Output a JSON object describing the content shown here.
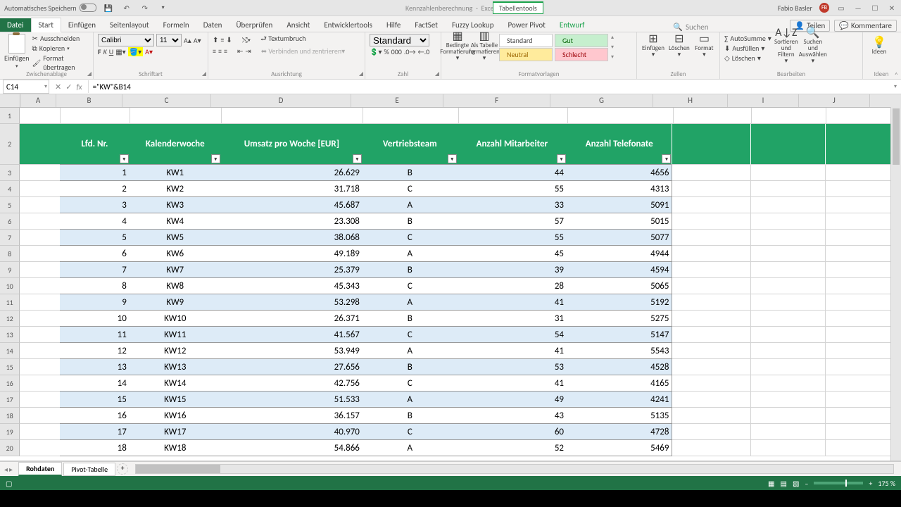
{
  "title": {
    "autosave": "Automatisches Speichern",
    "doc": "Kennzahlenberechnung",
    "app": "Excel",
    "tools": "Tabellentools",
    "user": "Fabio Basler",
    "initials": "FB"
  },
  "menu": {
    "file": "Datei",
    "tabs": [
      "Start",
      "Einfügen",
      "Seitenlayout",
      "Formeln",
      "Daten",
      "Überprüfen",
      "Ansicht",
      "Entwicklertools",
      "Hilfe",
      "FactSet",
      "Fuzzy Lookup",
      "Power Pivot",
      "Entwurf"
    ],
    "active": "Start",
    "search": "Suchen",
    "share": "Teilen",
    "comments": "Kommentare"
  },
  "ribbon": {
    "clipboard": {
      "paste": "Einfügen",
      "cut": "Ausschneiden",
      "copy": "Kopieren",
      "format": "Format übertragen",
      "label": "Zwischenablage"
    },
    "font": {
      "name": "Calibri",
      "size": "11",
      "label": "Schriftart"
    },
    "align": {
      "wrap": "Textumbruch",
      "merge": "Verbinden und zentrieren",
      "label": "Ausrichtung"
    },
    "number": {
      "format": "Standard",
      "label": "Zahl"
    },
    "styles": {
      "cond": "Bedingte Formatierung",
      "astable": "Als Tabelle formatieren",
      "std": "Standard",
      "gut": "Gut",
      "neutral": "Neutral",
      "bad": "Schlecht",
      "label": "Formatvorlagen"
    },
    "cells": {
      "insert": "Einfügen",
      "delete": "Löschen",
      "format": "Format",
      "label": "Zellen"
    },
    "editing": {
      "sum": "AutoSumme",
      "fill": "Ausfüllen",
      "clear": "Löschen",
      "sort": "Sortieren und Filtern",
      "find": "Suchen und Auswählen",
      "label": "Bearbeiten"
    },
    "ideas": {
      "label": "Ideen"
    }
  },
  "cellref": {
    "name": "C14",
    "formula": "=\"KW\"&B14"
  },
  "columns": {
    "A": 50,
    "B": 93,
    "C": 125,
    "D": 198,
    "E": 130,
    "F": 151,
    "G": 145,
    "H": 105,
    "I": 100,
    "J": 100
  },
  "headers": [
    "Lfd. Nr.",
    "Kalenderwoche",
    "Umsatz pro Woche [EUR]",
    "Vertriebsteam",
    "Anzahl Mitarbeiter",
    "Anzahl Telefonate"
  ],
  "chart_data": {
    "type": "table",
    "rows": [
      {
        "n": 1,
        "kw": "KW1",
        "umsatz": "26.629",
        "team": "B",
        "ma": 44,
        "tel": 4656
      },
      {
        "n": 2,
        "kw": "KW2",
        "umsatz": "31.718",
        "team": "C",
        "ma": 55,
        "tel": 4313
      },
      {
        "n": 3,
        "kw": "KW3",
        "umsatz": "45.687",
        "team": "A",
        "ma": 33,
        "tel": 5091
      },
      {
        "n": 4,
        "kw": "KW4",
        "umsatz": "23.308",
        "team": "B",
        "ma": 57,
        "tel": 5015
      },
      {
        "n": 5,
        "kw": "KW5",
        "umsatz": "38.068",
        "team": "C",
        "ma": 55,
        "tel": 5077
      },
      {
        "n": 6,
        "kw": "KW6",
        "umsatz": "49.189",
        "team": "A",
        "ma": 45,
        "tel": 4944
      },
      {
        "n": 7,
        "kw": "KW7",
        "umsatz": "25.379",
        "team": "B",
        "ma": 39,
        "tel": 4594
      },
      {
        "n": 8,
        "kw": "KW8",
        "umsatz": "45.343",
        "team": "C",
        "ma": 28,
        "tel": 5065
      },
      {
        "n": 9,
        "kw": "KW9",
        "umsatz": "53.298",
        "team": "A",
        "ma": 41,
        "tel": 5192
      },
      {
        "n": 10,
        "kw": "KW10",
        "umsatz": "26.371",
        "team": "B",
        "ma": 31,
        "tel": 5275
      },
      {
        "n": 11,
        "kw": "KW11",
        "umsatz": "41.567",
        "team": "C",
        "ma": 54,
        "tel": 5147
      },
      {
        "n": 12,
        "kw": "KW12",
        "umsatz": "53.949",
        "team": "A",
        "ma": 41,
        "tel": 5543
      },
      {
        "n": 13,
        "kw": "KW13",
        "umsatz": "27.656",
        "team": "B",
        "ma": 53,
        "tel": 4528
      },
      {
        "n": 14,
        "kw": "KW14",
        "umsatz": "42.756",
        "team": "C",
        "ma": 41,
        "tel": 4165
      },
      {
        "n": 15,
        "kw": "KW15",
        "umsatz": "51.533",
        "team": "A",
        "ma": 49,
        "tel": 4241
      },
      {
        "n": 16,
        "kw": "KW16",
        "umsatz": "36.157",
        "team": "B",
        "ma": 43,
        "tel": 5135
      },
      {
        "n": 17,
        "kw": "KW17",
        "umsatz": "40.970",
        "team": "C",
        "ma": 60,
        "tel": 4728
      },
      {
        "n": 18,
        "kw": "KW18",
        "umsatz": "54.866",
        "team": "A",
        "ma": 52,
        "tel": 5469
      }
    ]
  },
  "sheets": {
    "active": "Rohdaten",
    "other": "Pivot-Tabelle"
  },
  "status": {
    "zoom": "175 %"
  }
}
